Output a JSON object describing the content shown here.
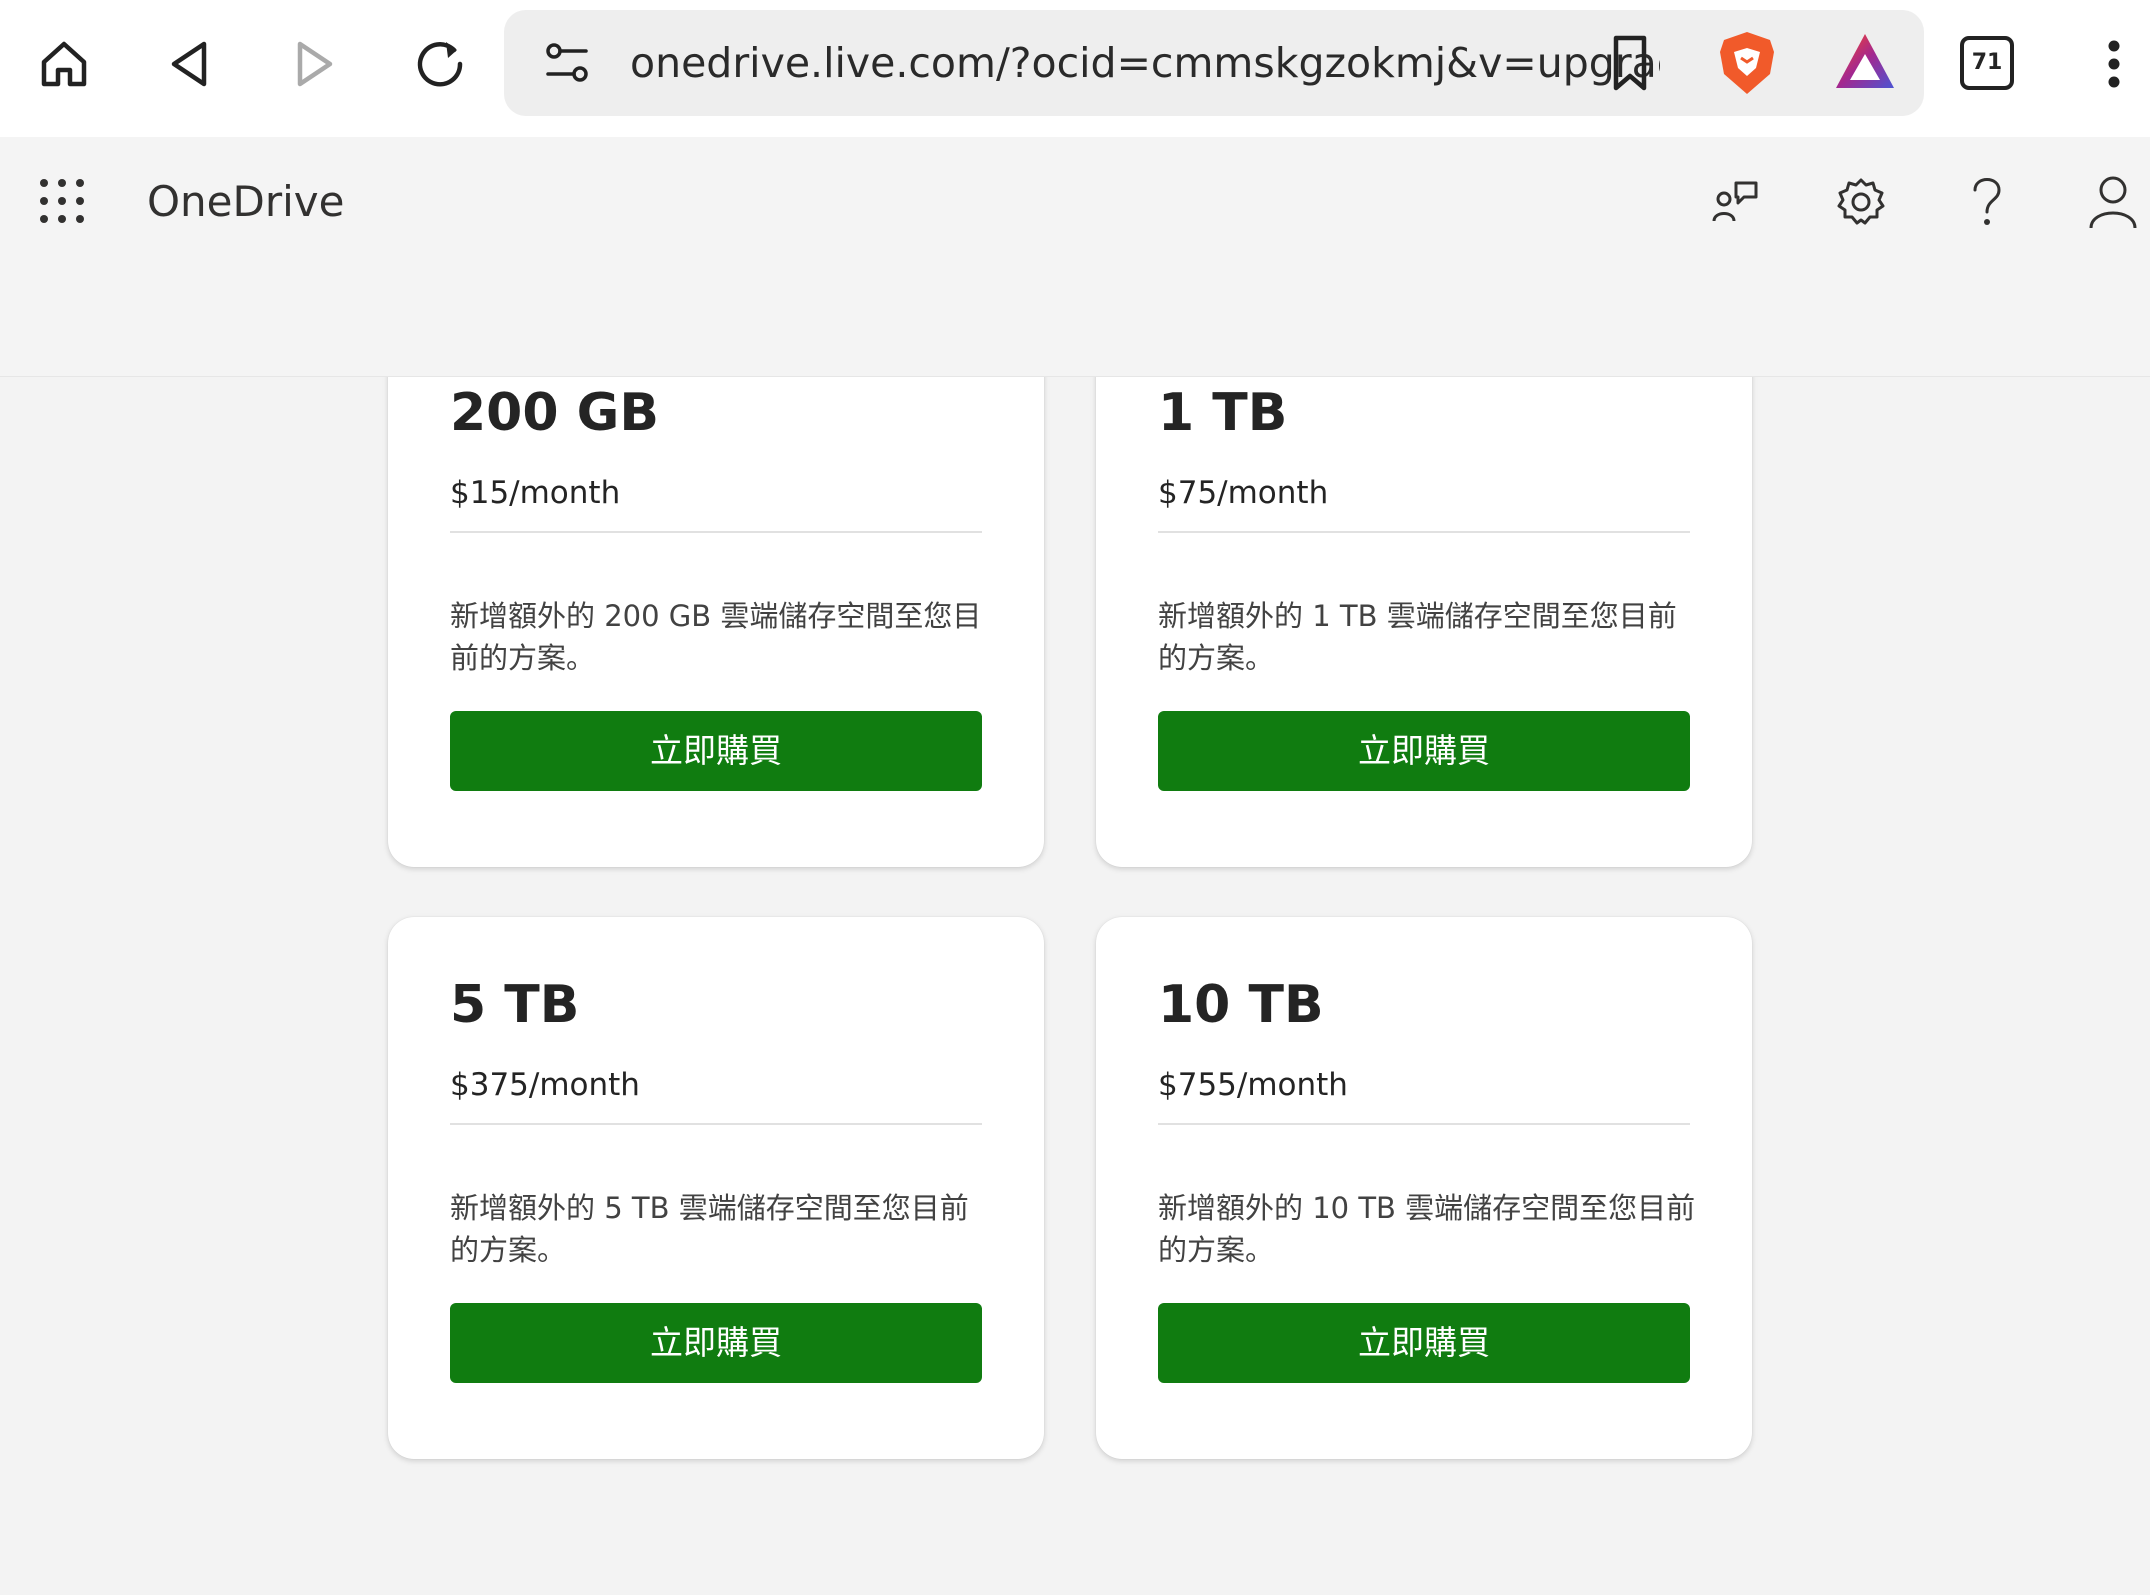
{
  "browser": {
    "url": "onedrive.live.com/?ocid=cmmskgzokmj&v=upgrade",
    "tab_count": "71",
    "icons": [
      "home-icon",
      "back-icon",
      "forward-icon",
      "reload-icon",
      "site-settings-icon",
      "bookmark-icon",
      "brave-shields-icon",
      "brave-rewards-icon",
      "tabs-icon",
      "more-menu-icon"
    ]
  },
  "header": {
    "app_title": "OneDrive",
    "icons": [
      "app-launcher-icon",
      "feedback-icon",
      "settings-icon",
      "help-icon",
      "account-icon"
    ]
  },
  "plans": [
    {
      "title": "200 GB",
      "price": "$15/month",
      "description": "新增額外的 200 GB 雲端儲存空間至您目前的方案。",
      "button": "立即購買"
    },
    {
      "title": "1 TB",
      "price": "$75/month",
      "description": "新增額外的 1 TB 雲端儲存空間至您目前的方案。",
      "button": "立即購買"
    },
    {
      "title": "5 TB",
      "price": "$375/month",
      "description": "新增額外的 5 TB 雲端儲存空間至您目前的方案。",
      "button": "立即購買"
    },
    {
      "title": "10 TB",
      "price": "$755/month",
      "description": "新增額外的 10 TB 雲端儲存空間至您目前的方案。",
      "button": "立即購買"
    }
  ],
  "colors": {
    "buy_button": "#107c10",
    "page_background": "#f3f3f3",
    "card_background": "#ffffff"
  }
}
